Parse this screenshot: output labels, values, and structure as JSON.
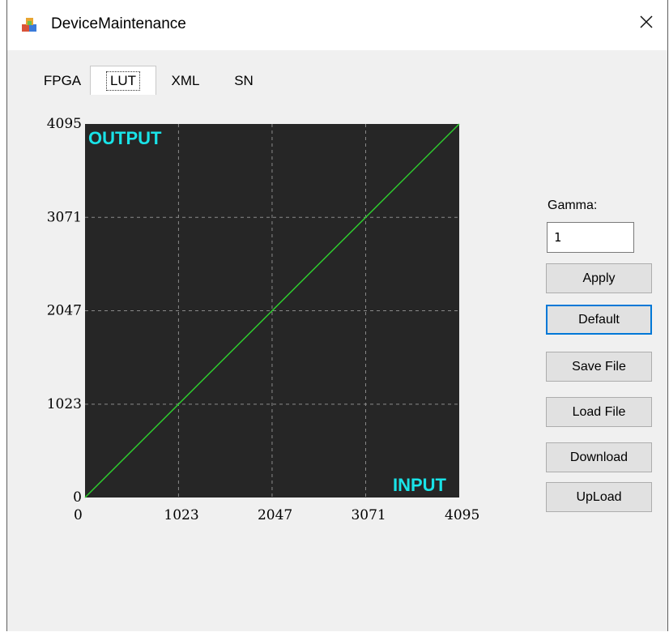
{
  "window": {
    "title": "DeviceMaintenance"
  },
  "tabs": [
    {
      "label": "FPGA",
      "active": false
    },
    {
      "label": "LUT",
      "active": true
    },
    {
      "label": "XML",
      "active": false
    },
    {
      "label": "SN",
      "active": false
    }
  ],
  "chart_data": {
    "type": "line",
    "title": "",
    "corner_labels": {
      "top_left": "OUTPUT",
      "bottom_right": "INPUT"
    },
    "x_ticks": [
      "0",
      "1023",
      "2047",
      "3071",
      "4095"
    ],
    "y_ticks": [
      "0",
      "1023",
      "2047",
      "3071",
      "4095"
    ],
    "xlim": [
      0,
      4095
    ],
    "ylim": [
      0,
      4095
    ],
    "grid": true,
    "series": [
      {
        "x": [
          0,
          4095
        ],
        "y": [
          0,
          4095
        ],
        "color": "#2ecc2e"
      }
    ],
    "colors": {
      "background": "#262626",
      "grid": "#8a8a8a",
      "corner_label": "#19e3e8"
    }
  },
  "gamma": {
    "label": "Gamma:",
    "value": "1"
  },
  "buttons": {
    "apply": "Apply",
    "default": "Default",
    "save_file": "Save File",
    "load_file": "Load File",
    "download": "Download",
    "upload": "UpLoad"
  }
}
